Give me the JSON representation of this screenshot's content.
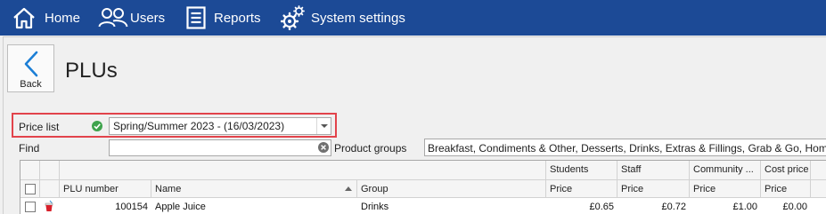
{
  "topbar": {
    "items": [
      {
        "label": "Home",
        "icon": "home-icon"
      },
      {
        "label": "Users",
        "icon": "users-icon"
      },
      {
        "label": "Reports",
        "icon": "reports-icon"
      },
      {
        "label": "System settings",
        "icon": "gears-icon"
      }
    ]
  },
  "page": {
    "back_label": "Back",
    "title": "PLUs"
  },
  "filters": {
    "price_list_label": "Price list",
    "price_list_value": "Spring/Summer 2023 - (16/03/2023)",
    "find_label": "Find",
    "find_value": "",
    "product_groups_label": "Product groups",
    "product_groups_value": "Breakfast, Condiments & Other, Desserts, Drinks, Extras & Fillings, Grab & Go, Home Baking & ..."
  },
  "grid": {
    "band_headers": [
      "Students",
      "Staff",
      "Community ...",
      "Cost price"
    ],
    "columns": [
      "PLU number",
      "Name",
      "Group",
      "Price",
      "Price",
      "Price",
      "Price"
    ],
    "rows": [
      {
        "plu": "100154",
        "name": "Apple Juice",
        "group": "Drinks",
        "students": "£0.65",
        "staff": "£0.72",
        "community": "£1.00",
        "cost": "£0.00"
      }
    ]
  },
  "colors": {
    "topbar": "#1c4a96",
    "highlight": "#e2434b",
    "check": "#3fa34d",
    "back_chevron": "#1c7fd6"
  }
}
